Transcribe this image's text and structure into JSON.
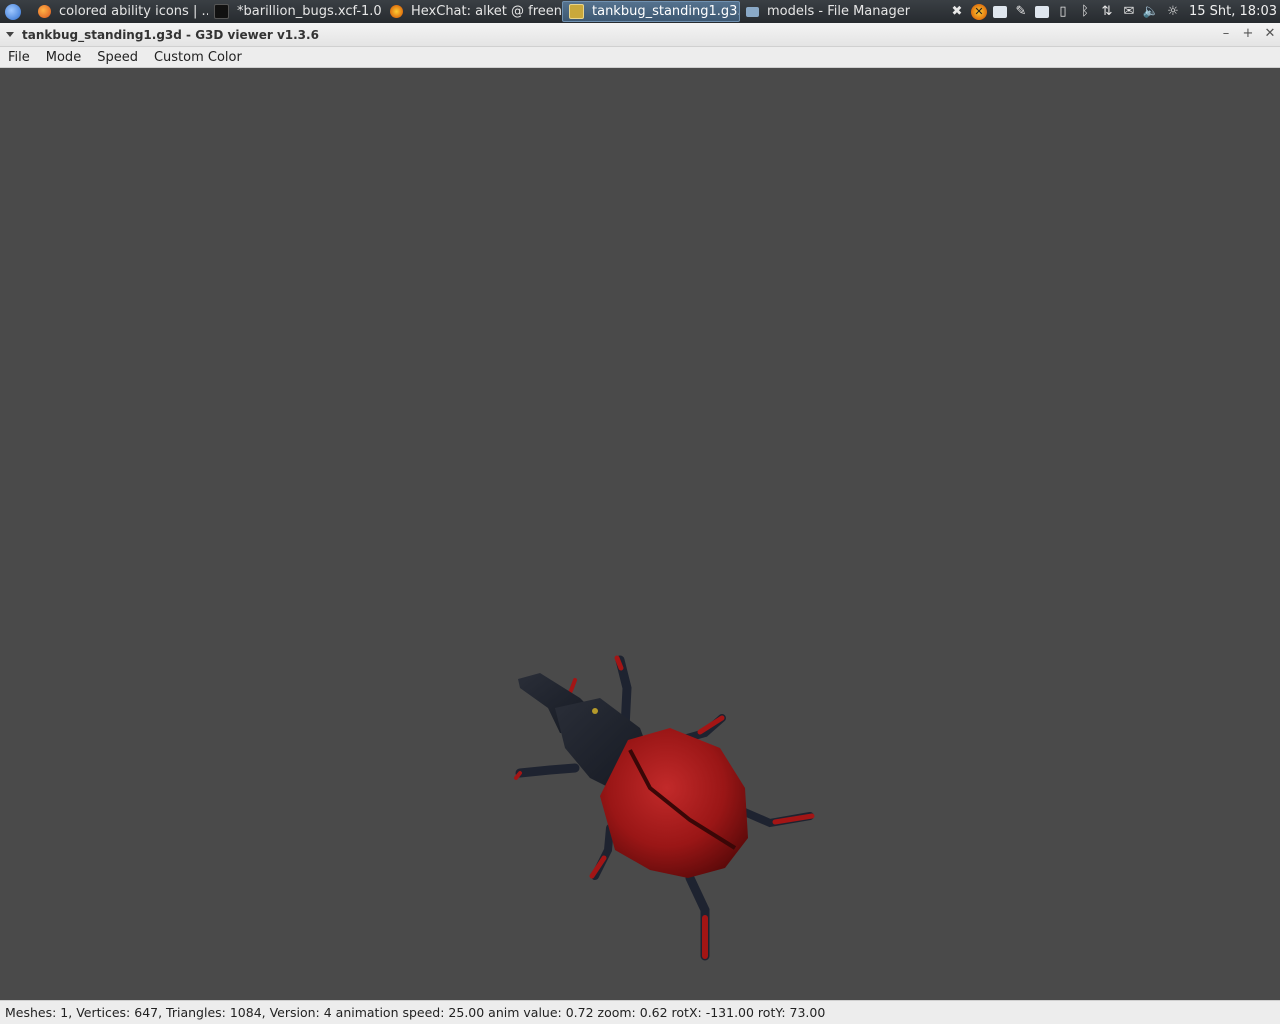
{
  "panel": {
    "tasks": [
      {
        "label": "colored ability icons | ...",
        "icon": "firefox-icon",
        "active": false
      },
      {
        "label": "*barillion_bugs.xcf-1.0 ...",
        "icon": "gimp-icon",
        "active": false
      },
      {
        "label": "HexChat: alket @ freen...",
        "icon": "hexchat-icon",
        "active": false
      },
      {
        "label": "tankbug_standing1.g3...",
        "icon": "g3d-viewer-icon",
        "active": true
      },
      {
        "label": "models - File Manager",
        "icon": "folder-icon",
        "active": false
      }
    ],
    "clock": "15 Sht, 18:03"
  },
  "window": {
    "title": "tankbug_standing1.g3d - G3D viewer v1.3.6"
  },
  "menu": {
    "file": "File",
    "mode": "Mode",
    "speed": "Speed",
    "custom_color": "Custom Color"
  },
  "viewport": {
    "background": "#4a4a4a",
    "model": "tankbug-beetle"
  },
  "status": {
    "text": "Meshes: 1, Vertices: 647, Triangles: 1084, Version: 4 animation speed: 25.00 anim value: 0.72 zoom: 0.62 rotX: -131.00 rotY: 73.00"
  }
}
